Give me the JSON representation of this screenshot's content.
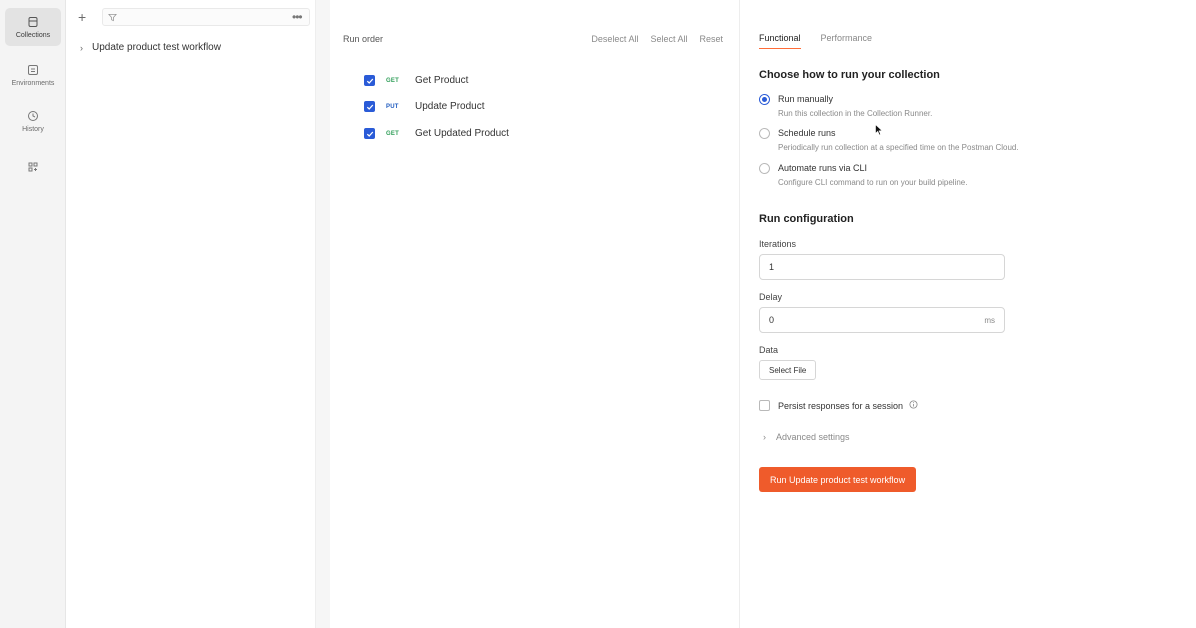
{
  "rail": {
    "items": [
      {
        "label": "Collections",
        "icon": "collections-icon",
        "active": true
      },
      {
        "label": "Environments",
        "icon": "environments-icon",
        "active": false
      },
      {
        "label": "History",
        "icon": "history-icon",
        "active": false
      },
      {
        "label": "",
        "icon": "apps-icon",
        "active": false
      }
    ]
  },
  "sidebar": {
    "collection_name": "Update product test workflow"
  },
  "run_order": {
    "title": "Run order",
    "actions": [
      "Deselect All",
      "Select All",
      "Reset"
    ],
    "requests": [
      {
        "method": "GET",
        "name": "Get Product",
        "checked": true
      },
      {
        "method": "PUT",
        "name": "Update Product",
        "checked": true
      },
      {
        "method": "GET",
        "name": "Get Updated Product",
        "checked": true
      }
    ]
  },
  "config": {
    "tabs": [
      "Functional",
      "Performance"
    ],
    "choose_title": "Choose how to run your collection",
    "options": [
      {
        "label": "Run manually",
        "desc": "Run this collection in the Collection Runner.",
        "selected": true
      },
      {
        "label": "Schedule runs",
        "desc": "Periodically run collection at a specified time on the Postman Cloud.",
        "selected": false
      },
      {
        "label": "Automate runs via CLI",
        "desc": "Configure CLI command to run on your build pipeline.",
        "selected": false
      }
    ],
    "run_config_title": "Run configuration",
    "iterations_label": "Iterations",
    "iterations_value": "1",
    "delay_label": "Delay",
    "delay_value": "0",
    "delay_unit": "ms",
    "data_label": "Data",
    "select_file_label": "Select File",
    "persist_label": "Persist responses for a session",
    "advanced_label": "Advanced settings",
    "run_button_label": "Run Update product test workflow"
  },
  "colors": {
    "accent": "#ef5b2b",
    "checkbox": "#2a5bd7",
    "get": "#2f9e58",
    "put": "#1f5bbf"
  }
}
